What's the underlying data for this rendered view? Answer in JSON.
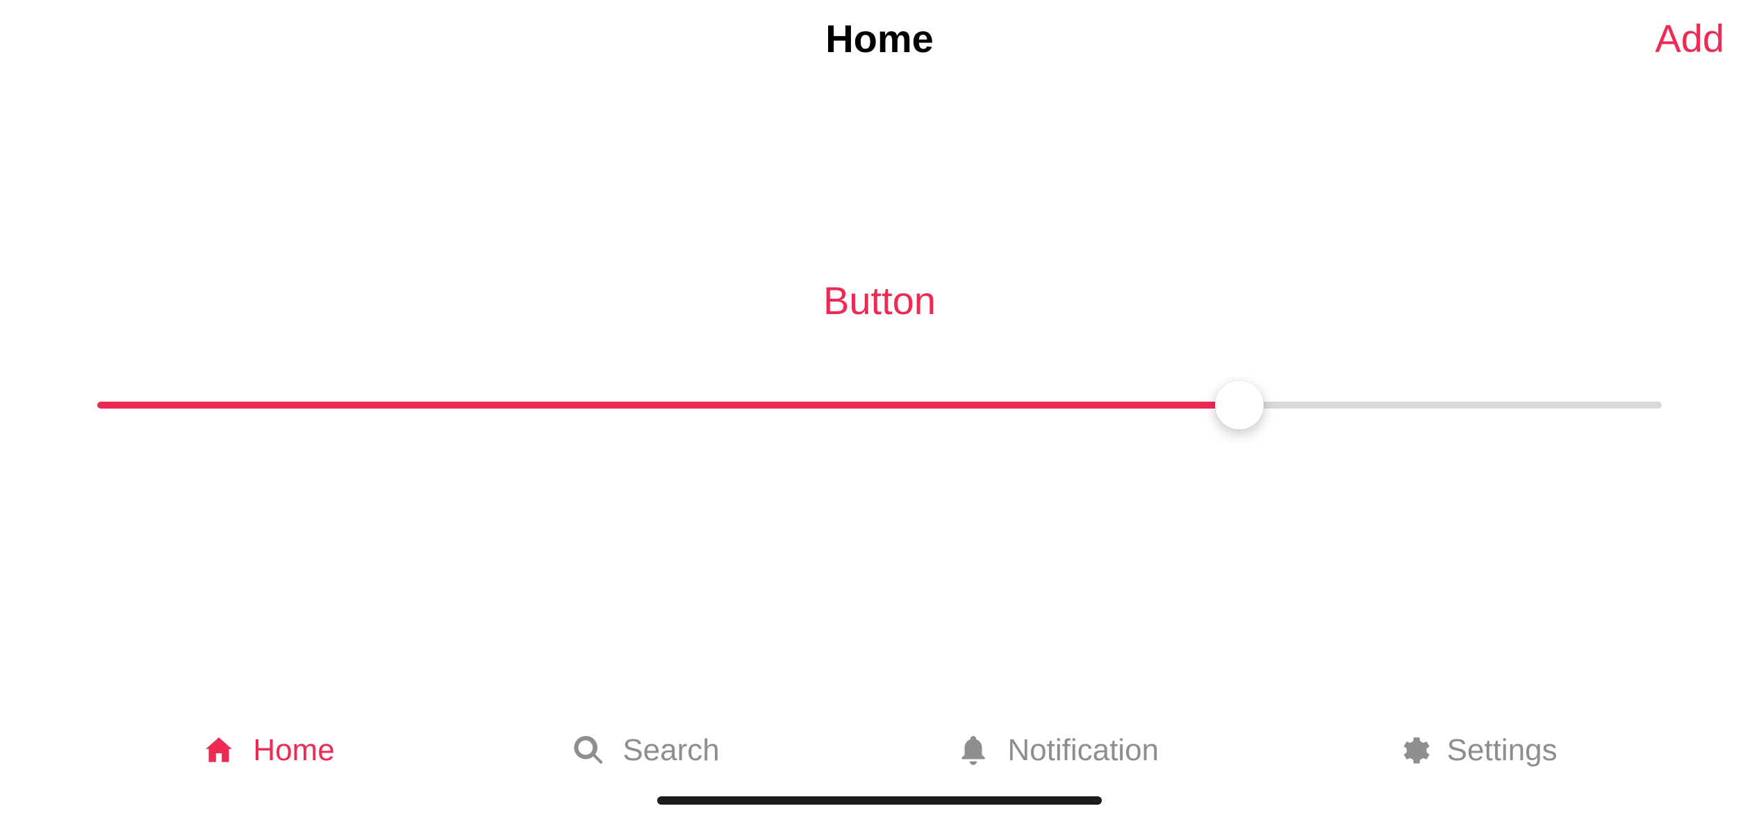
{
  "colors": {
    "accent": "#ed2a54",
    "inactive": "#8e8e8e"
  },
  "navbar": {
    "title": "Home",
    "add_label": "Add"
  },
  "main": {
    "button_label": "Button",
    "slider_value_percent": 73
  },
  "tabbar": {
    "items": [
      {
        "label": "Home",
        "icon": "home-icon",
        "active": true
      },
      {
        "label": "Search",
        "icon": "search-icon",
        "active": false
      },
      {
        "label": "Notification",
        "icon": "bell-icon",
        "active": false
      },
      {
        "label": "Settings",
        "icon": "gear-icon",
        "active": false
      }
    ]
  }
}
